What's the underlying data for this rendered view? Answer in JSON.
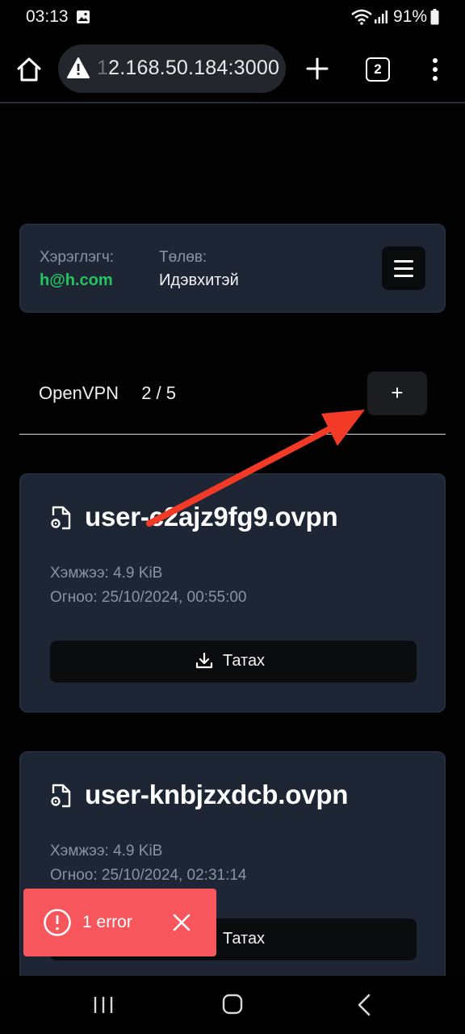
{
  "status_bar": {
    "time": "03:13",
    "battery_percent": "91%"
  },
  "browser": {
    "url_faded": "1",
    "url": "2.168.50.184:3000",
    "tab_count": "2"
  },
  "user_card": {
    "user_label": "Хэрэглэгч:",
    "user_email": "h@h.com",
    "status_label": "Төлөв:",
    "status_value": "Идэвхитэй"
  },
  "vpn_section": {
    "title": "OpenVPN",
    "count": "2 / 5",
    "add_label": "+"
  },
  "files": [
    {
      "name": "user-c2ajz9fg9.ovpn",
      "size": "Хэмжээ: 4.9 KiB",
      "date": "Огноо: 25/10/2024, 00:55:00",
      "download_label": "Татах"
    },
    {
      "name": "user-knbjzxdcb.ovpn",
      "size": "Хэмжээ: 4.9 KiB",
      "date": "Огноо: 25/10/2024, 02:31:14",
      "download_label": "Татах"
    }
  ],
  "toast": {
    "text": "1 error"
  },
  "colors": {
    "accent_green": "#22c55e",
    "card_bg": "#1e2534",
    "toast_red": "#f7565c",
    "annotation_arrow": "#f23a26"
  },
  "icons": [
    "home-icon",
    "warning-icon",
    "plus-icon",
    "tabs-icon",
    "more-icon",
    "menu-icon",
    "file-settings-icon",
    "download-icon",
    "error-icon",
    "close-icon",
    "recents-icon",
    "nav-home-icon",
    "back-icon"
  ]
}
